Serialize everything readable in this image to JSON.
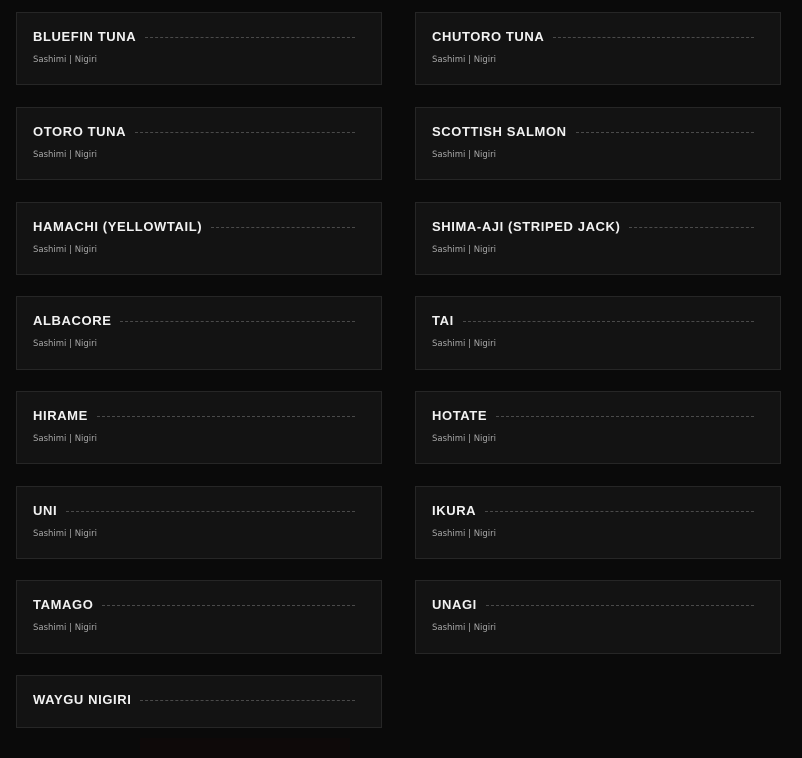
{
  "menu": {
    "items": [
      {
        "name": "BLUEFIN TUNA",
        "sub": "Sashimi | Nigiri"
      },
      {
        "name": "CHUTORO TUNA",
        "sub": "Sashimi | Nigiri"
      },
      {
        "name": "OTORO TUNA",
        "sub": "Sashimi | Nigiri"
      },
      {
        "name": "SCOTTISH SALMON",
        "sub": "Sashimi | Nigiri"
      },
      {
        "name": "HAMACHI (YELLOWTAIL)",
        "sub": "Sashimi | Nigiri"
      },
      {
        "name": "SHIMA-AJI (STRIPED JACK)",
        "sub": "Sashimi | Nigiri"
      },
      {
        "name": "ALBACORE",
        "sub": "Sashimi | Nigiri"
      },
      {
        "name": "TAI",
        "sub": "Sashimi | Nigiri"
      },
      {
        "name": "HIRAME",
        "sub": "Sashimi | Nigiri"
      },
      {
        "name": "HOTATE",
        "sub": "Sashimi | Nigiri"
      },
      {
        "name": "UNI",
        "sub": "Sashimi | Nigiri"
      },
      {
        "name": "IKURA",
        "sub": "Sashimi | Nigiri"
      },
      {
        "name": "TAMAGO",
        "sub": "Sashimi | Nigiri"
      },
      {
        "name": "UNAGI",
        "sub": "Sashimi | Nigiri"
      },
      {
        "name": "WAYGU NIGIRI",
        "sub": ""
      }
    ]
  }
}
